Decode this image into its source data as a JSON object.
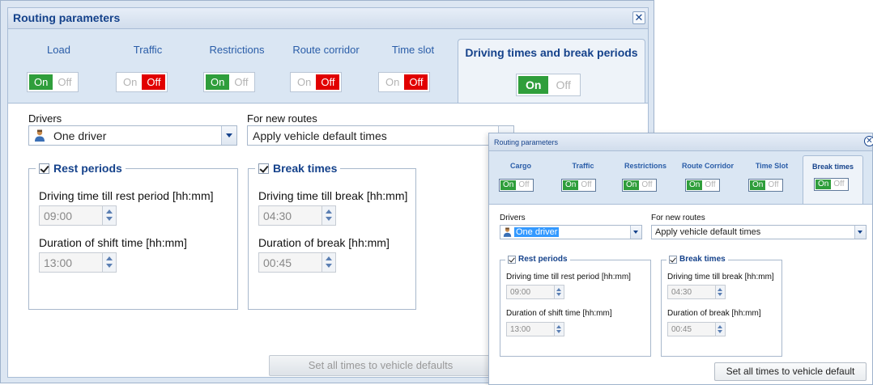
{
  "main": {
    "title": "Routing parameters",
    "close_glyph": "✕",
    "tabs": [
      {
        "label": "Load",
        "toggle_on": "On",
        "toggle_off": "Off",
        "state": "on"
      },
      {
        "label": "Traffic",
        "toggle_on": "On",
        "toggle_off": "Off",
        "state": "off"
      },
      {
        "label": "Restrictions",
        "toggle_on": "On",
        "toggle_off": "Off",
        "state": "on"
      },
      {
        "label": "Route corridor",
        "toggle_on": "On",
        "toggle_off": "Off",
        "state": "off"
      },
      {
        "label": "Time slot",
        "toggle_on": "On",
        "toggle_off": "Off",
        "state": "off"
      },
      {
        "label": "Driving times and break periods",
        "toggle_on": "On",
        "toggle_off": "Off",
        "state": "on",
        "active": true
      }
    ],
    "drivers_label": "Drivers",
    "drivers_value": "One driver",
    "new_routes_label": "For new routes",
    "new_routes_value": "Apply vehicle default times",
    "rest": {
      "legend": "Rest periods",
      "drive_label": "Driving time till rest period [hh:mm]",
      "drive_value": "09:00",
      "shift_label": "Duration of shift time [hh:mm]",
      "shift_value": "13:00"
    },
    "break": {
      "legend": "Break times",
      "drive_label": "Driving time till break [hh:mm]",
      "drive_value": "04:30",
      "duration_label": "Duration of break [hh:mm]",
      "duration_value": "00:45"
    },
    "set_defaults_label": "Set all times to vehicle defaults"
  },
  "overlay": {
    "title": "Routing parameters",
    "close_glyph": "✕",
    "tabs": [
      {
        "label": "Cargo",
        "toggle_on": "On",
        "toggle_off": "Off"
      },
      {
        "label": "Traffic",
        "toggle_on": "On",
        "toggle_off": "Off"
      },
      {
        "label": "Restrictions",
        "toggle_on": "On",
        "toggle_off": "Off"
      },
      {
        "label": "Route Corridor",
        "toggle_on": "On",
        "toggle_off": "Off"
      },
      {
        "label": "Time Slot",
        "toggle_on": "On",
        "toggle_off": "Off"
      },
      {
        "label": "Break times",
        "toggle_on": "On",
        "toggle_off": "Off",
        "active": true
      }
    ],
    "drivers_label": "Drivers",
    "drivers_value": "One driver",
    "new_routes_label": "For new routes",
    "new_routes_value": "Apply vehicle default times",
    "rest": {
      "legend": "Rest periods",
      "drive_label": "Driving time till rest period [hh:mm]",
      "drive_value": "09:00",
      "shift_label": "Duration of shift time [hh:mm]",
      "shift_value": "13:00"
    },
    "break": {
      "legend": "Break times",
      "drive_label": "Driving time till break [hh:mm]",
      "drive_value": "04:30",
      "duration_label": "Duration of break [hh:mm]",
      "duration_value": "00:45"
    },
    "set_defaults_label": "Set all times to vehicle default"
  },
  "colors": {
    "accent": "#15428b",
    "toggle_on": "#2f9e3b",
    "toggle_off": "#e10000"
  },
  "icons": {
    "driver": "driver-person-icon",
    "close": "close-icon",
    "dropdown": "chevron-down-icon",
    "checkbox": "checkbox-checked-icon"
  }
}
